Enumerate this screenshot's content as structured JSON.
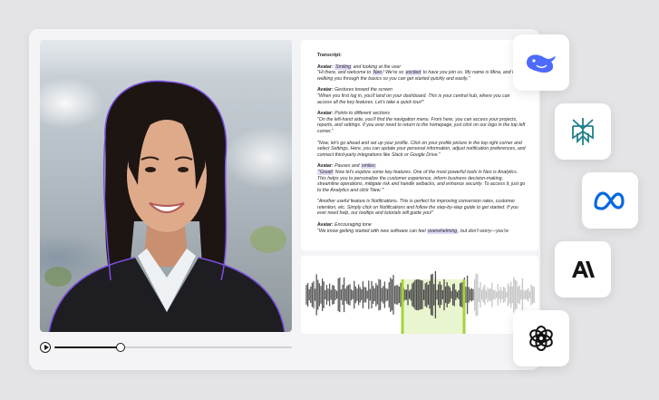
{
  "player": {
    "progress": 0.28
  },
  "transcript": {
    "title": "Transcript:",
    "segments": [
      {
        "speaker": "Avatar:",
        "cue_pre": "",
        "cue_hl": "Smiling",
        "cue_post": " and looking at the user",
        "line": "\"Hi there, and welcome to ",
        "line_hl1": "Neo",
        "line_mid": "! We're so ",
        "line_hl2": "excited",
        "line_post": " to have you join us. My name is Mina, and I'll be walking you through the basics so you can get started quickly and easily.\""
      },
      {
        "speaker": "Avatar:",
        "cue": " Gestures toward the screen",
        "line": "\"When you first log in, you'll land on your dashboard. This is your central hub, where you can access all the key features. Let's take a quick tour!\""
      },
      {
        "speaker": "Avatar:",
        "cue": " Points to different sections",
        "line": "\"On the left-hand side, you'll find the navigation menu. From here, you can access your projects, reports, and settings. If you ever need to return to the homepage, just click on our logo in the top left corner.\""
      },
      {
        "line": "\"Now, let's go ahead and set up your profile. Click on your profile picture in the top right corner and select Settings.  Here, you can update your personal information, adjust notification preferences, and connect third-party integrations like Slack or Google Drive.\""
      },
      {
        "speaker": "Avatar:",
        "cue_pre": " Pauses and ",
        "cue_hl": "smiles",
        "line_hl": "\"Great!",
        "line": " Now let's explore some key features. One of the most powerful tools in Neo is Analytics. This helps you to personalize the customer experience, inform business decision-making, streamline operations, mitigate risk and handle setbacks, and enhance security. To access it, just go to the Analytics and click 'New.'\""
      },
      {
        "line": "\"Another useful feature is Notifications. This is perfect for improving conversion rates, customer retention, etc. Simply click on Notifications and follow the step-by-step guide to get started. If you ever need help, our tooltips and tutorials will guide you!\""
      },
      {
        "speaker": "Avatar:",
        "cue": " Encouraging tone",
        "line_pre": "\"We know getting started with new software can feel ",
        "line_hl": "overwhelming",
        "line_post": ", but don't worry—you're"
      }
    ]
  },
  "logos": [
    {
      "name": "deepseek-icon",
      "color": "#4d6bfe"
    },
    {
      "name": "perplexity-icon",
      "color": "#20808d"
    },
    {
      "name": "meta-icon",
      "color": "#0668e1"
    },
    {
      "name": "anthropic-icon",
      "color": "#141413"
    },
    {
      "name": "openai-icon",
      "color": "#111111"
    }
  ],
  "colors": {
    "highlight": "#e3daf7",
    "waveform_dark": "#5a5a5a",
    "waveform_light": "#c6c6c6",
    "waveform_selected": "#a6d33a",
    "avatar_outline": "#7b4fe0"
  }
}
